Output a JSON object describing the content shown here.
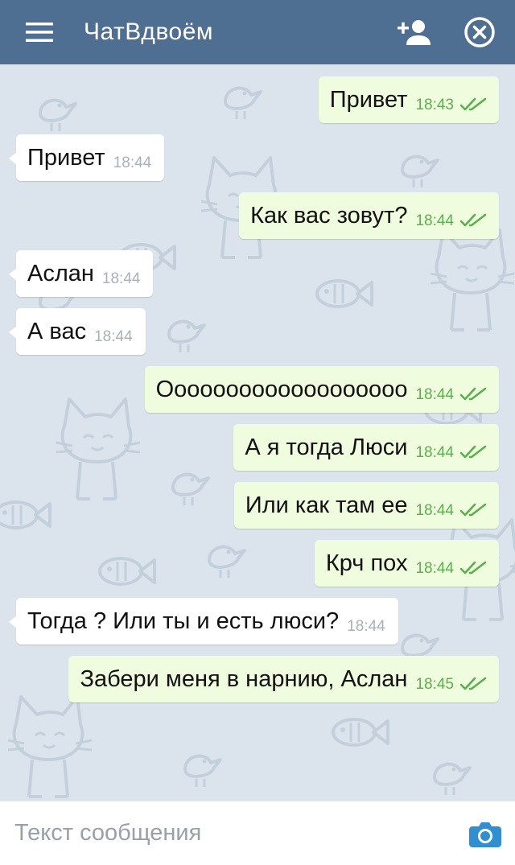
{
  "header": {
    "title": "ЧатВдвоём",
    "menu_icon": "hamburger-icon",
    "add_user_icon": "add-user-icon",
    "close_icon": "close-circle-icon",
    "background_color": "#4f6f92"
  },
  "messages": [
    {
      "direction": "out",
      "text": "Привет",
      "time": "18:43",
      "status": "read"
    },
    {
      "direction": "in",
      "text": "Привет",
      "time": "18:44"
    },
    {
      "direction": "out",
      "text": "Как вас зовут?",
      "time": "18:44",
      "status": "read"
    },
    {
      "direction": "in",
      "text": "Аслан",
      "time": "18:44"
    },
    {
      "direction": "in",
      "text": "А вас",
      "time": "18:44"
    },
    {
      "direction": "out",
      "text": "Ооооооооооооооооооо",
      "time": "18:44",
      "status": "read"
    },
    {
      "direction": "out",
      "text": "А я тогда Люси",
      "time": "18:44",
      "status": "read"
    },
    {
      "direction": "out",
      "text": "Или как там ее",
      "time": "18:44",
      "status": "read"
    },
    {
      "direction": "out",
      "text": "Крч пох",
      "time": "18:44",
      "status": "read"
    },
    {
      "direction": "in",
      "text": "Тогда ? Или ты и есть люси?",
      "time": "18:44"
    },
    {
      "direction": "out",
      "text": "Забери меня в нарнию, Аслан",
      "time": "18:45",
      "status": "read"
    }
  ],
  "composer": {
    "placeholder": "Текст сообщения",
    "value": "",
    "camera_icon": "camera-icon"
  },
  "colors": {
    "outgoing_bubble": "#effdde",
    "incoming_bubble": "#ffffff",
    "read_ticks": "#5cae4e",
    "chat_background": "#dbe4ec",
    "camera_accent": "#2f8fd0"
  }
}
